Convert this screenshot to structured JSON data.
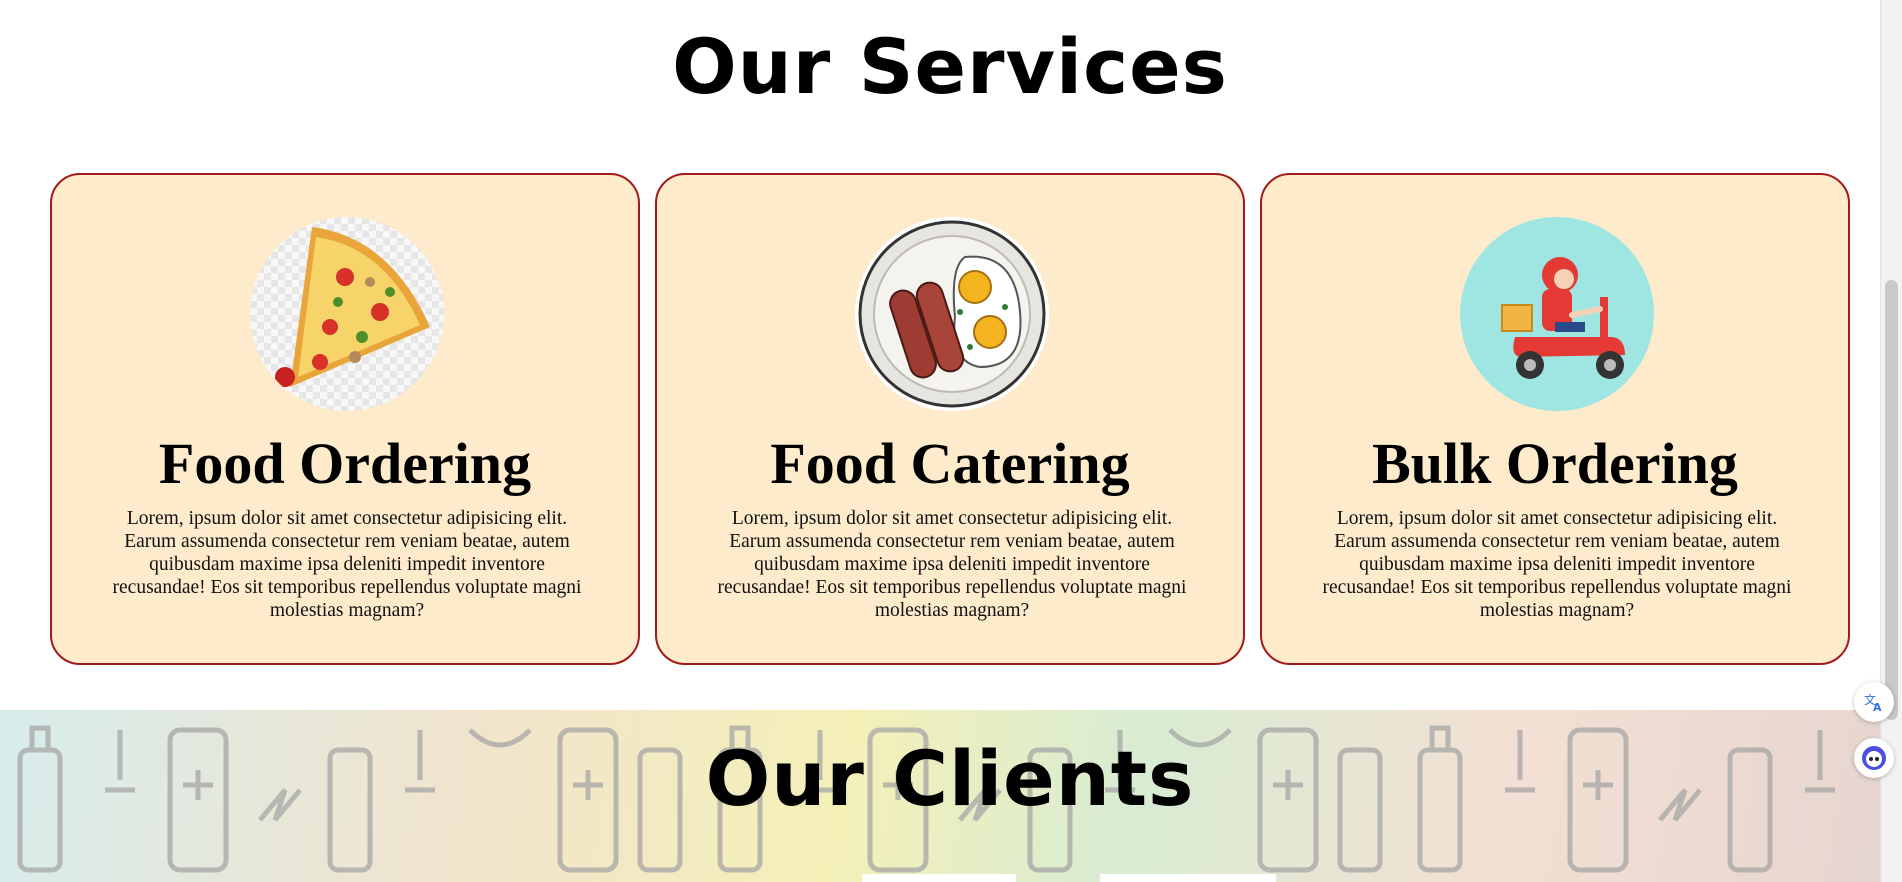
{
  "services": {
    "title": "Our Services",
    "cards": [
      {
        "title": "Food Ordering",
        "text": "Lorem, ipsum dolor sit amet consectetur adipisicing elit. Earum assumenda consectetur rem veniam beatae, autem quibusdam maxime ipsa deleniti impedit inventore recusandae! Eos sit temporibus repellendus voluptate magni molestias magnam?",
        "image_icon": "pizza-slice-icon"
      },
      {
        "title": "Food Catering",
        "text": "Lorem, ipsum dolor sit amet consectetur adipisicing elit. Earum assumenda consectetur rem veniam beatae, autem quibusdam maxime ipsa deleniti impedit inventore recusandae! Eos sit temporibus repellendus voluptate magni molestias magnam?",
        "image_icon": "breakfast-plate-icon"
      },
      {
        "title": "Bulk Ordering",
        "text": "Lorem, ipsum dolor sit amet consectetur adipisicing elit. Earum assumenda consectetur rem veniam beatae, autem quibusdam maxime ipsa deleniti impedit inventore recusandae! Eos sit temporibus repellendus voluptate magni molestias magnam?",
        "image_icon": "delivery-scooter-icon"
      }
    ]
  },
  "clients": {
    "title": "Our Clients"
  },
  "floating_buttons": {
    "translate_icon": "translate-icon",
    "assistant_icon": "assistant-icon"
  },
  "colors": {
    "card_background": "#feebcb",
    "card_border": "#a11a1a",
    "title_text": "#000000"
  }
}
